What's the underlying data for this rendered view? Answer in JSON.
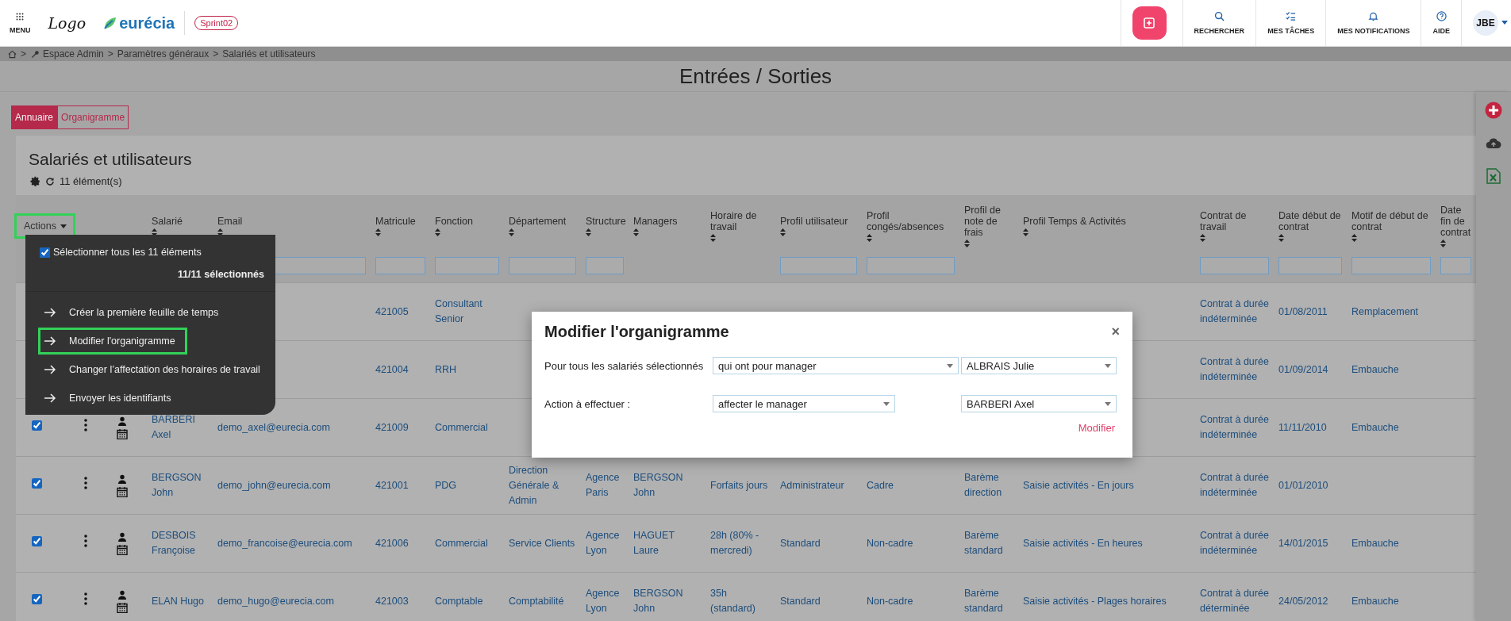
{
  "topbar": {
    "menu_label": "MENU",
    "logo_text": "Logo",
    "brand": "eurécia",
    "sprint_badge": "Sprint02",
    "nav": [
      {
        "kind": "search",
        "label": "RECHERCHER"
      },
      {
        "kind": "tasks",
        "label": "MES TÂCHES"
      },
      {
        "kind": "bell",
        "label": "MES NOTIFICATIONS"
      },
      {
        "kind": "help",
        "label": "AIDE"
      }
    ],
    "avatar": "JBE"
  },
  "breadcrumb": {
    "separator": ">",
    "items": [
      "Espace Admin",
      "Paramètres généraux",
      "Salariés et utilisateurs"
    ]
  },
  "page_title": "Entrées / Sorties",
  "tabs": [
    {
      "label": "Annuaire",
      "selected": true
    },
    {
      "label": "Organigramme",
      "selected": false
    }
  ],
  "card": {
    "title": "Salariés et utilisateurs",
    "count": "11 élément(s)"
  },
  "table": {
    "actions_label": "Actions",
    "actions_highlighted": true,
    "columns": [
      {
        "label": "Salarié"
      },
      {
        "label": "Email",
        "filter": true
      },
      {
        "label": "Matricule",
        "filter": true
      },
      {
        "label": "Fonction",
        "filter": true
      },
      {
        "label": "Département",
        "filter": true
      },
      {
        "label": "Structure",
        "filter": true
      },
      {
        "label": "Managers",
        "filter": false
      },
      {
        "label": "Horaire de travail",
        "filter": false
      },
      {
        "label": "Profil utilisateur",
        "filter": true
      },
      {
        "label": "Profil congés/absences",
        "filter": true
      },
      {
        "label": "Profil de note de frais",
        "filter": false
      },
      {
        "label": "Profil Temps & Activités",
        "filter": false
      },
      {
        "label": "Contrat de travail",
        "filter": true
      },
      {
        "label": "Date début de contrat",
        "filter": true
      },
      {
        "label": "Motif de début de contrat",
        "filter": true
      },
      {
        "label": "Date fin de contrat",
        "filter": true
      }
    ],
    "rows": [
      {
        "cells": [
          null,
          null,
          "421005",
          "Consultant Senior",
          null,
          null,
          null,
          null,
          null,
          null,
          null,
          null,
          "Contrat à durée indéterminée",
          "01/08/2011",
          "Remplacement",
          null
        ]
      },
      {
        "cells": [
          null,
          null,
          "421004",
          "RRH",
          null,
          null,
          null,
          null,
          null,
          null,
          null,
          null,
          "Contrat à durée indéterminée",
          "01/09/2014",
          "Embauche",
          null
        ]
      },
      {
        "checked": true,
        "cells": [
          "BARBERI Axel",
          "demo_axel@eurecia.com",
          "421009",
          "Commercial",
          null,
          null,
          null,
          null,
          null,
          null,
          null,
          null,
          "Contrat à durée indéterminée",
          "11/11/2010",
          "Embauche",
          null
        ]
      },
      {
        "checked": true,
        "cells": [
          "BERGSON John",
          "demo_john@eurecia.com",
          "421001",
          "PDG",
          "Direction Générale & Admin",
          "Agence Paris",
          "BERGSON John",
          "Forfaits jours",
          "Administrateur",
          "Cadre",
          "Barème direction",
          "Saisie activités - En jours",
          "Contrat à durée indéterminée",
          "01/01/2010",
          null,
          null
        ]
      },
      {
        "checked": true,
        "cells": [
          "DESBOIS Françoise",
          "demo_francoise@eurecia.com",
          "421006",
          "Commercial",
          "Service Clients",
          "Agence Lyon",
          "HAGUET Laure",
          "28h (80% - mercredi)",
          "Standard",
          "Non-cadre",
          "Barème standard",
          "Saisie activités - En heures",
          "Contrat à durée indéterminée",
          "14/01/2015",
          "Embauche",
          null
        ]
      },
      {
        "checked": true,
        "cells": [
          "ELAN Hugo",
          "demo_hugo@eurecia.com",
          "421003",
          "Comptable",
          "Comptabilité",
          "Agence Lyon",
          "BERGSON John",
          "35h (standard)",
          "Standard",
          "Non-cadre",
          "Barème standard",
          "Saisie activités - Plages horaires",
          "Contrat à durée déterminée",
          "24/05/2012",
          "Embauche",
          null
        ]
      }
    ]
  },
  "actions_menu": {
    "select_all": {
      "label": "Sélectionner tous les 11 éléments",
      "checked": true
    },
    "selection_count": "11/11 sélectionnés",
    "items": [
      {
        "label": "Créer la première feuille de temps",
        "highlighted": false
      },
      {
        "label": "Modifier l'organigramme",
        "highlighted": true
      },
      {
        "label": "Changer l’affectation des horaires de travail",
        "highlighted": false
      },
      {
        "label": "Envoyer les identifiants",
        "highlighted": false
      }
    ]
  },
  "modal": {
    "title": "Modifier l'organigramme",
    "close": "×",
    "rows": [
      {
        "label": "Pour tous les salariés sélectionnés",
        "select_1": "qui ont pour manager",
        "select_2": "ALBRAIS Julie",
        "wide": true
      },
      {
        "label": "Action à effectuer :",
        "select_1": "affecter le manager",
        "select_2": "BARBERI Axel",
        "wide": false
      }
    ],
    "submit": "Modifier"
  }
}
